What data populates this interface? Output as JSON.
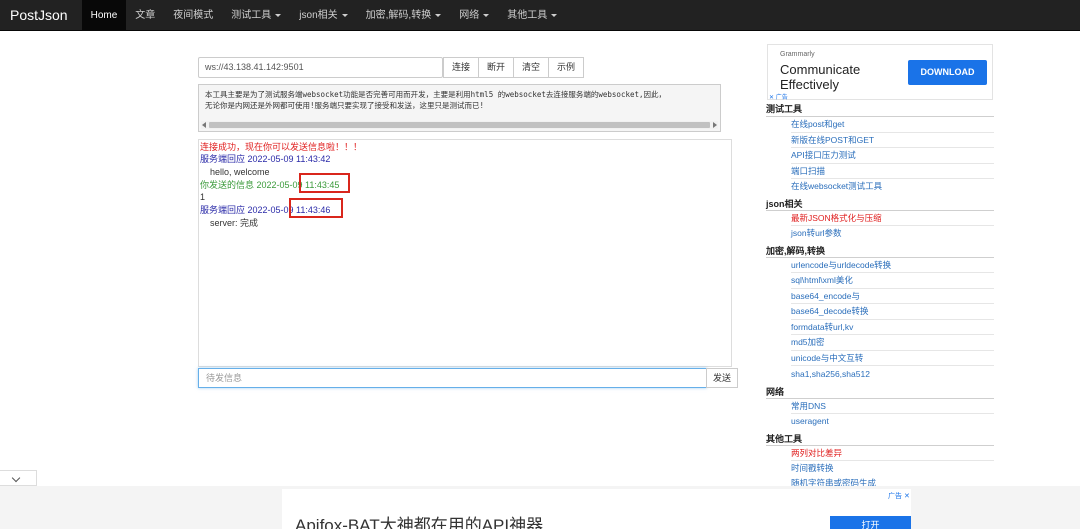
{
  "navbar": {
    "brand": "PostJson",
    "items": [
      {
        "label": "Home",
        "active": true,
        "dropdown": false
      },
      {
        "label": "文章",
        "active": false,
        "dropdown": false
      },
      {
        "label": "夜间模式",
        "active": false,
        "dropdown": false
      },
      {
        "label": "测试工具",
        "active": false,
        "dropdown": true
      },
      {
        "label": "json相关",
        "active": false,
        "dropdown": true
      },
      {
        "label": "加密,解码,转换",
        "active": false,
        "dropdown": true
      },
      {
        "label": "网络",
        "active": false,
        "dropdown": true
      },
      {
        "label": "其他工具",
        "active": false,
        "dropdown": true
      }
    ]
  },
  "ws": {
    "url": "ws://43.138.41.142:9501",
    "buttons": {
      "connect": "连接",
      "disconnect": "断开",
      "clear": "清空",
      "example": "示例"
    }
  },
  "description": {
    "line1": "本工具主要是为了测试服务端websocket功能是否完善可用而开发，主要是利用html5 的websocket去连接服务端的websocket,因此，",
    "line2": "无论你是内网还是外网都可使用!服务端只要实现了接受和发送，这里只是测试而已!"
  },
  "messages": {
    "connected": "连接成功，现在你可以发送信息啦！！！",
    "recv1_header": "服务端回应 2022-05-09 11:43:42",
    "recv1_body": "hello, welcome",
    "sent_header": "你发送的信息 2022-05-09 11:43:45",
    "sent_body": "1",
    "recv2_header": "服务端回应 2022-05-09 11:43:46",
    "recv2_body": "server: 完成"
  },
  "send": {
    "placeholder": "待发信息",
    "button": "发送"
  },
  "right_ad": {
    "brand": "Grammarly",
    "headline_line1": "Communicate",
    "headline_line2": "Effectively",
    "button": "DOWNLOAD",
    "mark": "✕ 广告"
  },
  "sidebar": {
    "sections": [
      {
        "title": "测试工具",
        "links": [
          {
            "label": "在线post和get",
            "highlight": false
          },
          {
            "label": "新版在线POST和GET",
            "highlight": false
          },
          {
            "label": "API接口压力测试",
            "highlight": false
          },
          {
            "label": "端口扫描",
            "highlight": false
          },
          {
            "label": "在线websocket测试工具",
            "highlight": false
          }
        ]
      },
      {
        "title": "json相关",
        "links": [
          {
            "label": "最新JSON格式化与压缩",
            "highlight": true
          },
          {
            "label": "json转url参数",
            "highlight": false
          }
        ]
      },
      {
        "title": "加密,解码,转换",
        "links": [
          {
            "label": "urlencode与urldecode转换",
            "highlight": false
          },
          {
            "label": "sql\\html\\xml美化",
            "highlight": false
          },
          {
            "label": "base64_encode与",
            "highlight": false
          },
          {
            "label": "base64_decode转换",
            "highlight": false
          },
          {
            "label": "formdata转url,kv",
            "highlight": false
          },
          {
            "label": "md5加密",
            "highlight": false
          },
          {
            "label": "unicode与中文互转",
            "highlight": false
          },
          {
            "label": "sha1,sha256,sha512",
            "highlight": false
          }
        ]
      },
      {
        "title": "网络",
        "links": [
          {
            "label": "常用DNS",
            "highlight": false
          },
          {
            "label": "useragent",
            "highlight": false
          }
        ]
      },
      {
        "title": "其他工具",
        "links": [
          {
            "label": "两列对比差异",
            "highlight": true
          },
          {
            "label": "时间戳转换",
            "highlight": false
          },
          {
            "label": "随机字符串或密码生成",
            "highlight": false
          }
        ]
      }
    ]
  },
  "bottom_ad": {
    "title": "Apifox-BAT大神都在用的API神器",
    "button": "打开",
    "mark": "广告 ✕"
  }
}
